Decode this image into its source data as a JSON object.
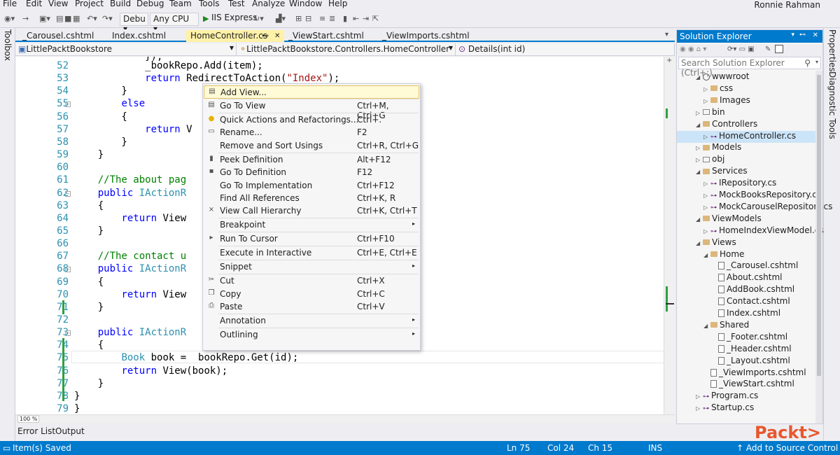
{
  "menu": {
    "items": [
      "File",
      "Edit",
      "View",
      "Project",
      "Build",
      "Debug",
      "Team",
      "Tools",
      "Test",
      "Analyze",
      "Window",
      "Help"
    ],
    "user": "Ronnie Rahman"
  },
  "toolbar": {
    "config": "Debu",
    "platform": "Any CPU",
    "run_target": "IIS Express"
  },
  "left_strip": {
    "label": "Toolbox"
  },
  "right_strip": {
    "labels": [
      "Properties",
      "Diagnostic Tools"
    ]
  },
  "tabs": [
    {
      "label": "_Carousel.cshtml",
      "active": false
    },
    {
      "label": "Index.cshtml",
      "active": false
    },
    {
      "label": "HomeController.cs",
      "active": true
    },
    {
      "label": "_ViewStart.cshtml",
      "active": false
    },
    {
      "label": "_ViewImports.cshtml",
      "active": false
    }
  ],
  "nav": {
    "project": "LittlePacktBookstore",
    "class": "LittlePacktBookstore.Controllers.HomeController",
    "member": "Details(int id)"
  },
  "code_lines": [
    {
      "n": "52",
      "html": "            _bookRepo.Add(item);"
    },
    {
      "n": "53",
      "html": "            <span class=\"kw\">return</span> RedirectToAction(<span class=\"st\">\"Index\"</span>);"
    },
    {
      "n": "54",
      "html": "        }"
    },
    {
      "n": "55",
      "html": "        <span class=\"kw\">else</span>"
    },
    {
      "n": "56",
      "html": "        {"
    },
    {
      "n": "57",
      "html": "            <span class=\"kw\">return</span> V"
    },
    {
      "n": "58",
      "html": "        }"
    },
    {
      "n": "59",
      "html": "    }"
    },
    {
      "n": "60",
      "html": ""
    },
    {
      "n": "61",
      "html": "    <span class=\"cm\">//The about pag</span>"
    },
    {
      "n": "62",
      "html": "    <span class=\"kw\">public</span> <span class=\"ty\">IActionR</span>"
    },
    {
      "n": "63",
      "html": "    {"
    },
    {
      "n": "64",
      "html": "        <span class=\"kw\">return</span> View"
    },
    {
      "n": "65",
      "html": "    }"
    },
    {
      "n": "66",
      "html": ""
    },
    {
      "n": "67",
      "html": "    <span class=\"cm\">//The contact u</span>"
    },
    {
      "n": "68",
      "html": "    <span class=\"kw\">public</span> <span class=\"ty\">IActionR</span>"
    },
    {
      "n": "69",
      "html": "    {"
    },
    {
      "n": "70",
      "html": "        <span class=\"kw\">return</span> View"
    },
    {
      "n": "71",
      "html": "    }"
    },
    {
      "n": "72",
      "html": ""
    },
    {
      "n": "73",
      "html": "    <span class=\"kw\">public</span> <span class=\"ty\">IActionR</span>"
    },
    {
      "n": "74",
      "html": "    {"
    },
    {
      "n": "75",
      "html": "        <span class=\"ty\">Book</span> book = _bookRepo.Get(id);"
    },
    {
      "n": "76",
      "html": "        <span class=\"kw\">return</span> View(book);"
    },
    {
      "n": "77",
      "html": "    }"
    },
    {
      "n": "78",
      "html": "}"
    },
    {
      "n": "79",
      "html": "}"
    }
  ],
  "zoom": "100 %",
  "context_menu": [
    {
      "label": "Add View...",
      "shortcut": "",
      "icon": "add-view-icon",
      "glyph": "▤",
      "hl": true
    },
    {
      "sep": true
    },
    {
      "label": "Go To View",
      "shortcut": "Ctrl+M, Ctrl+G",
      "icon": "go-to-view-icon",
      "glyph": "▤"
    },
    {
      "sep": true
    },
    {
      "label": "Quick Actions and Refactorings...",
      "shortcut": "Ctrl+.",
      "icon": "lightbulb-icon",
      "glyph": "●"
    },
    {
      "label": "Rename...",
      "shortcut": "F2",
      "icon": "rename-icon",
      "glyph": "▭"
    },
    {
      "label": "Remove and Sort Usings",
      "shortcut": "Ctrl+R, Ctrl+G",
      "icon": "",
      "glyph": ""
    },
    {
      "sep": true
    },
    {
      "label": "Peek Definition",
      "shortcut": "Alt+F12",
      "icon": "peek-definition-icon",
      "glyph": "▮"
    },
    {
      "label": "Go To Definition",
      "shortcut": "F12",
      "icon": "go-to-definition-icon",
      "glyph": "▪"
    },
    {
      "label": "Go To Implementation",
      "shortcut": "Ctrl+F12",
      "icon": "",
      "glyph": ""
    },
    {
      "label": "Find All References",
      "shortcut": "Ctrl+K, R",
      "icon": "",
      "glyph": ""
    },
    {
      "label": "View Call Hierarchy",
      "shortcut": "Ctrl+K, Ctrl+T",
      "icon": "call-hierarchy-icon",
      "glyph": "⨯"
    },
    {
      "sep": true
    },
    {
      "label": "Breakpoint",
      "shortcut": "",
      "icon": "",
      "glyph": "",
      "submenu": true
    },
    {
      "sep": true
    },
    {
      "label": "Run To Cursor",
      "shortcut": "Ctrl+F10",
      "icon": "run-to-cursor-icon",
      "glyph": "▸"
    },
    {
      "sep": true
    },
    {
      "label": "Execute in Interactive",
      "shortcut": "Ctrl+E, Ctrl+E",
      "icon": "",
      "glyph": ""
    },
    {
      "sep": true
    },
    {
      "label": "Snippet",
      "shortcut": "",
      "icon": "",
      "glyph": "",
      "submenu": true
    },
    {
      "sep": true
    },
    {
      "label": "Cut",
      "shortcut": "Ctrl+X",
      "icon": "cut-icon",
      "glyph": "✂"
    },
    {
      "label": "Copy",
      "shortcut": "Ctrl+C",
      "icon": "copy-icon",
      "glyph": "❐"
    },
    {
      "label": "Paste",
      "shortcut": "Ctrl+V",
      "icon": "paste-icon",
      "glyph": "⎙"
    },
    {
      "sep": true
    },
    {
      "label": "Annotation",
      "shortcut": "",
      "icon": "",
      "glyph": "",
      "submenu": true
    },
    {
      "sep": true
    },
    {
      "label": "Outlining",
      "shortcut": "",
      "icon": "",
      "glyph": "",
      "submenu": true
    }
  ],
  "solution_explorer": {
    "title": "Solution Explorer",
    "search_placeholder": "Search Solution Explorer (Ctrl+;)",
    "tree": [
      {
        "label": "wwwroot",
        "depth": 1,
        "arrow": "◢",
        "kind": "globe"
      },
      {
        "label": "css",
        "depth": 2,
        "arrow": "▷",
        "kind": "folder"
      },
      {
        "label": "Images",
        "depth": 2,
        "arrow": "▷",
        "kind": "folder"
      },
      {
        "label": "bin",
        "depth": 1,
        "arrow": "▷",
        "kind": "bin"
      },
      {
        "label": "Controllers",
        "depth": 1,
        "arrow": "◢",
        "kind": "folder"
      },
      {
        "label": "HomeController.cs",
        "depth": 2,
        "arrow": "▷",
        "kind": "cs",
        "selected": true
      },
      {
        "label": "Models",
        "depth": 1,
        "arrow": "▷",
        "kind": "folder"
      },
      {
        "label": "obj",
        "depth": 1,
        "arrow": "▷",
        "kind": "bin"
      },
      {
        "label": "Services",
        "depth": 1,
        "arrow": "◢",
        "kind": "folder"
      },
      {
        "label": "IRepository.cs",
        "depth": 2,
        "arrow": "▷",
        "kind": "cs"
      },
      {
        "label": "MockBooksRepository.cs",
        "depth": 2,
        "arrow": "▷",
        "kind": "cs"
      },
      {
        "label": "MockCarouselRepository.cs",
        "depth": 2,
        "arrow": "▷",
        "kind": "cs"
      },
      {
        "label": "ViewModels",
        "depth": 1,
        "arrow": "◢",
        "kind": "folder"
      },
      {
        "label": "HomeIndexViewModel.cs",
        "depth": 2,
        "arrow": "▷",
        "kind": "cs"
      },
      {
        "label": "Views",
        "depth": 1,
        "arrow": "◢",
        "kind": "folder"
      },
      {
        "label": "Home",
        "depth": 2,
        "arrow": "◢",
        "kind": "folder"
      },
      {
        "label": "_Carousel.cshtml",
        "depth": 3,
        "arrow": "",
        "kind": "file"
      },
      {
        "label": "About.cshtml",
        "depth": 3,
        "arrow": "",
        "kind": "file"
      },
      {
        "label": "AddBook.cshtml",
        "depth": 3,
        "arrow": "",
        "kind": "file"
      },
      {
        "label": "Contact.cshtml",
        "depth": 3,
        "arrow": "",
        "kind": "file"
      },
      {
        "label": "Index.cshtml",
        "depth": 3,
        "arrow": "",
        "kind": "file"
      },
      {
        "label": "Shared",
        "depth": 2,
        "arrow": "◢",
        "kind": "folder"
      },
      {
        "label": "_Footer.cshtml",
        "depth": 3,
        "arrow": "",
        "kind": "file"
      },
      {
        "label": "_Header.cshtml",
        "depth": 3,
        "arrow": "",
        "kind": "file"
      },
      {
        "label": "_Layout.cshtml",
        "depth": 3,
        "arrow": "",
        "kind": "file"
      },
      {
        "label": "_ViewImports.cshtml",
        "depth": 2,
        "arrow": "",
        "kind": "file"
      },
      {
        "label": "_ViewStart.cshtml",
        "depth": 2,
        "arrow": "",
        "kind": "file"
      },
      {
        "label": "Program.cs",
        "depth": 1,
        "arrow": "▷",
        "kind": "cs"
      },
      {
        "label": "Startup.cs",
        "depth": 1,
        "arrow": "▷",
        "kind": "cs"
      }
    ]
  },
  "bottom_tabs": [
    "Error List",
    "Output"
  ],
  "status": {
    "message": "Item(s) Saved",
    "ln": "Ln 75",
    "col": "Col 24",
    "ch": "Ch 15",
    "mode": "INS",
    "source_control": "↑ Add to Source Control ▴"
  },
  "logo_text": "Packt>"
}
